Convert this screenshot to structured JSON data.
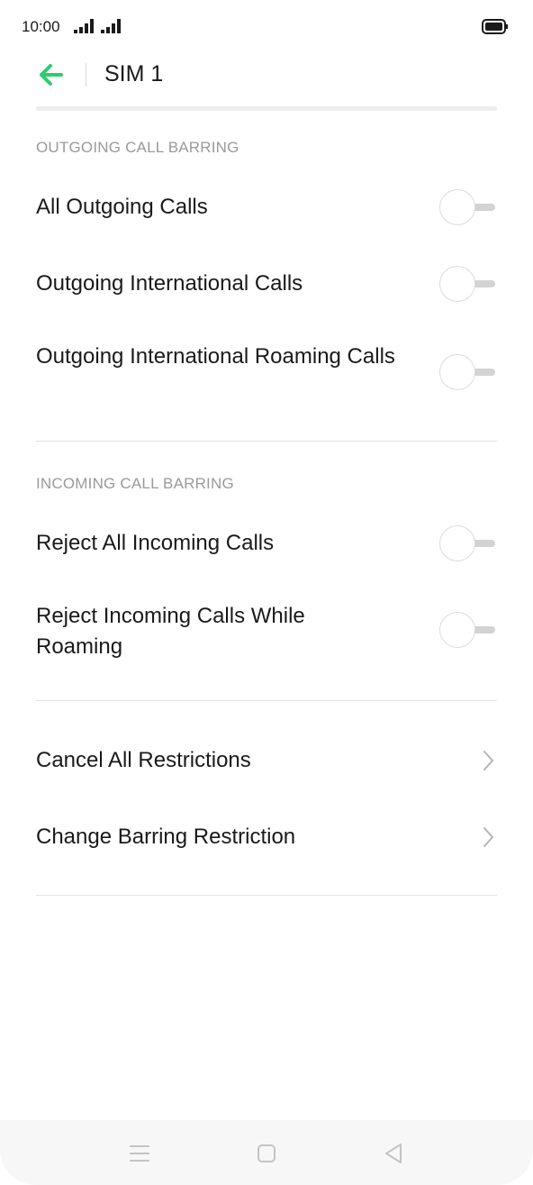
{
  "status_bar": {
    "time": "10:00",
    "icons": [
      "signal-icon",
      "signal-icon",
      "battery-icon"
    ]
  },
  "app_bar": {
    "back_icon": "arrow-left-icon",
    "title": "SIM 1",
    "accent_color": "#2ecc71"
  },
  "sections": {
    "outgoing": {
      "header": "OUTGOING CALL BARRING",
      "items": [
        {
          "label": "All Outgoing Calls",
          "enabled": false
        },
        {
          "label": "Outgoing International Calls",
          "enabled": false
        },
        {
          "label": "Outgoing International Roaming Calls",
          "enabled": false
        }
      ]
    },
    "incoming": {
      "header": "INCOMING CALL BARRING",
      "items": [
        {
          "label": "Reject All Incoming Calls",
          "enabled": false
        },
        {
          "label": "Reject Incoming Calls While Roaming",
          "enabled": false
        }
      ]
    },
    "actions": {
      "items": [
        {
          "label": "Cancel All Restrictions",
          "icon": "chevron-right-icon"
        },
        {
          "label": "Change Barring Restriction",
          "icon": "chevron-right-icon"
        }
      ]
    }
  },
  "nav_bar": {
    "icons": [
      "menu-icon",
      "home-square-icon",
      "back-triangle-icon"
    ]
  }
}
